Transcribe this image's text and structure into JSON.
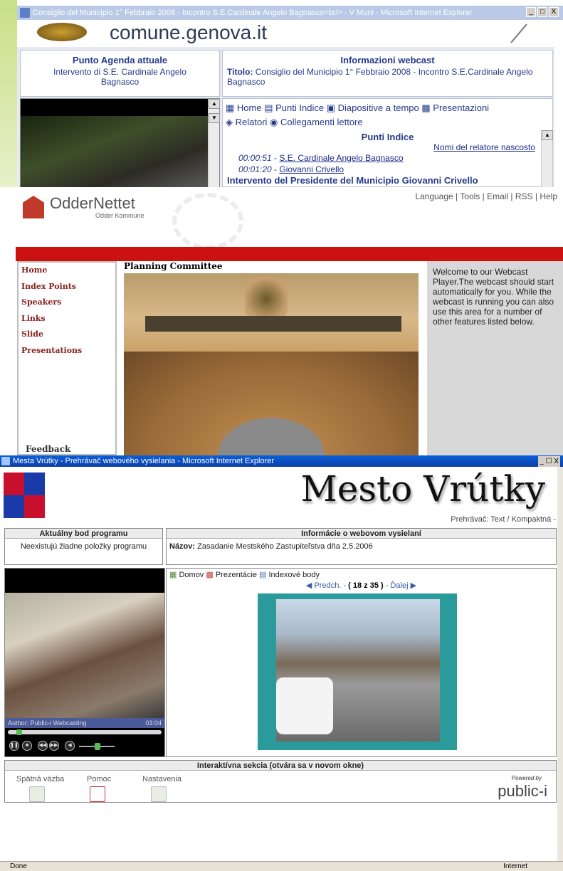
{
  "panel1": {
    "window_title": "Consiglio del Municipio 1° Febbraio 2008 - Incontro S.E.Cardinale Angelo Bagnasco<br/> - V Muni - Microsoft Internet Explorer",
    "window_buttons": [
      "_",
      "□",
      "X"
    ],
    "domain": "comune.genova.it",
    "agenda_header": "Punto Agenda attuale",
    "agenda_text": "Intervento di S.E. Cardinale Angelo Bagnasco",
    "info_header": "Informazioni webcast",
    "info_title_label": "Titolo:",
    "info_title": "Consiglio del Municipio 1° Febbraio 2008 - Incontro S.E.Cardinale Angelo Bagnasco",
    "tabs": [
      "Home",
      "Punti Indice",
      "Diapositive a tempo",
      "Presentazioni",
      "Relatori",
      "Collegamenti lettore"
    ],
    "index_header": "Punti Indice",
    "hide_speaker_names": "Nomi del relatore nascosto",
    "index_items": [
      {
        "time": "00:00:51",
        "name": "S.E. Cardinale Angelo Bagnasco"
      },
      {
        "time": "00:01:20",
        "name": "Giovanni Crivello"
      }
    ],
    "cut_heading": "Intervento del Presidente del Municipio Giovanni Crivello"
  },
  "panel2": {
    "logo_name": "OdderNettet",
    "logo_sub": "Odder Kommune",
    "toplinks": "Language | Tools | Email | RSS | Help",
    "nav": [
      "Home",
      "Index Points",
      "Speakers",
      "Links",
      "Slide",
      "Presentations"
    ],
    "feedback": "Feedback",
    "video_title": "Planning Committee",
    "welcome": "Welcome to our Webcast Player.The webcast should start automatically for you. While the webcast is running you can also use this area for a number of other features listed below."
  },
  "panel3": {
    "window_title": "Mesta Vrútky - Prehrávač webového vysielania - Microsoft Internet Explorer",
    "window_buttons": "_ ☐ X",
    "city": "Mesto Vrútky",
    "player_mode": "Prehrávač: Text / Kompaktná -",
    "agenda_header": "Aktuálny bod programu",
    "agenda_text": "Neexistujú žiadne položky programu",
    "info_header": "Informácie o webovom vysielaní",
    "name_label": "Názov:",
    "name_value": "Zasadanie Mestského Zastupiteľstva dňa 2.5.2006",
    "tabs": [
      "Domov",
      "Prezentácie",
      "Indexové body"
    ],
    "prev": "Predch.",
    "slide_counter": "( 18 z 35 )",
    "next": "Ďalej",
    "video_author": "Author: Public-i Webcasting",
    "video_time": "03:04",
    "interactive_header": "Interaktívna sekcia (otvára sa v novom okne)",
    "interactive_items": [
      "Spätná väzba",
      "Pomoc",
      "Nastavenia"
    ],
    "powered_by": "Powered by",
    "brand": "public-i",
    "status": "Done",
    "zone": "Internet"
  }
}
